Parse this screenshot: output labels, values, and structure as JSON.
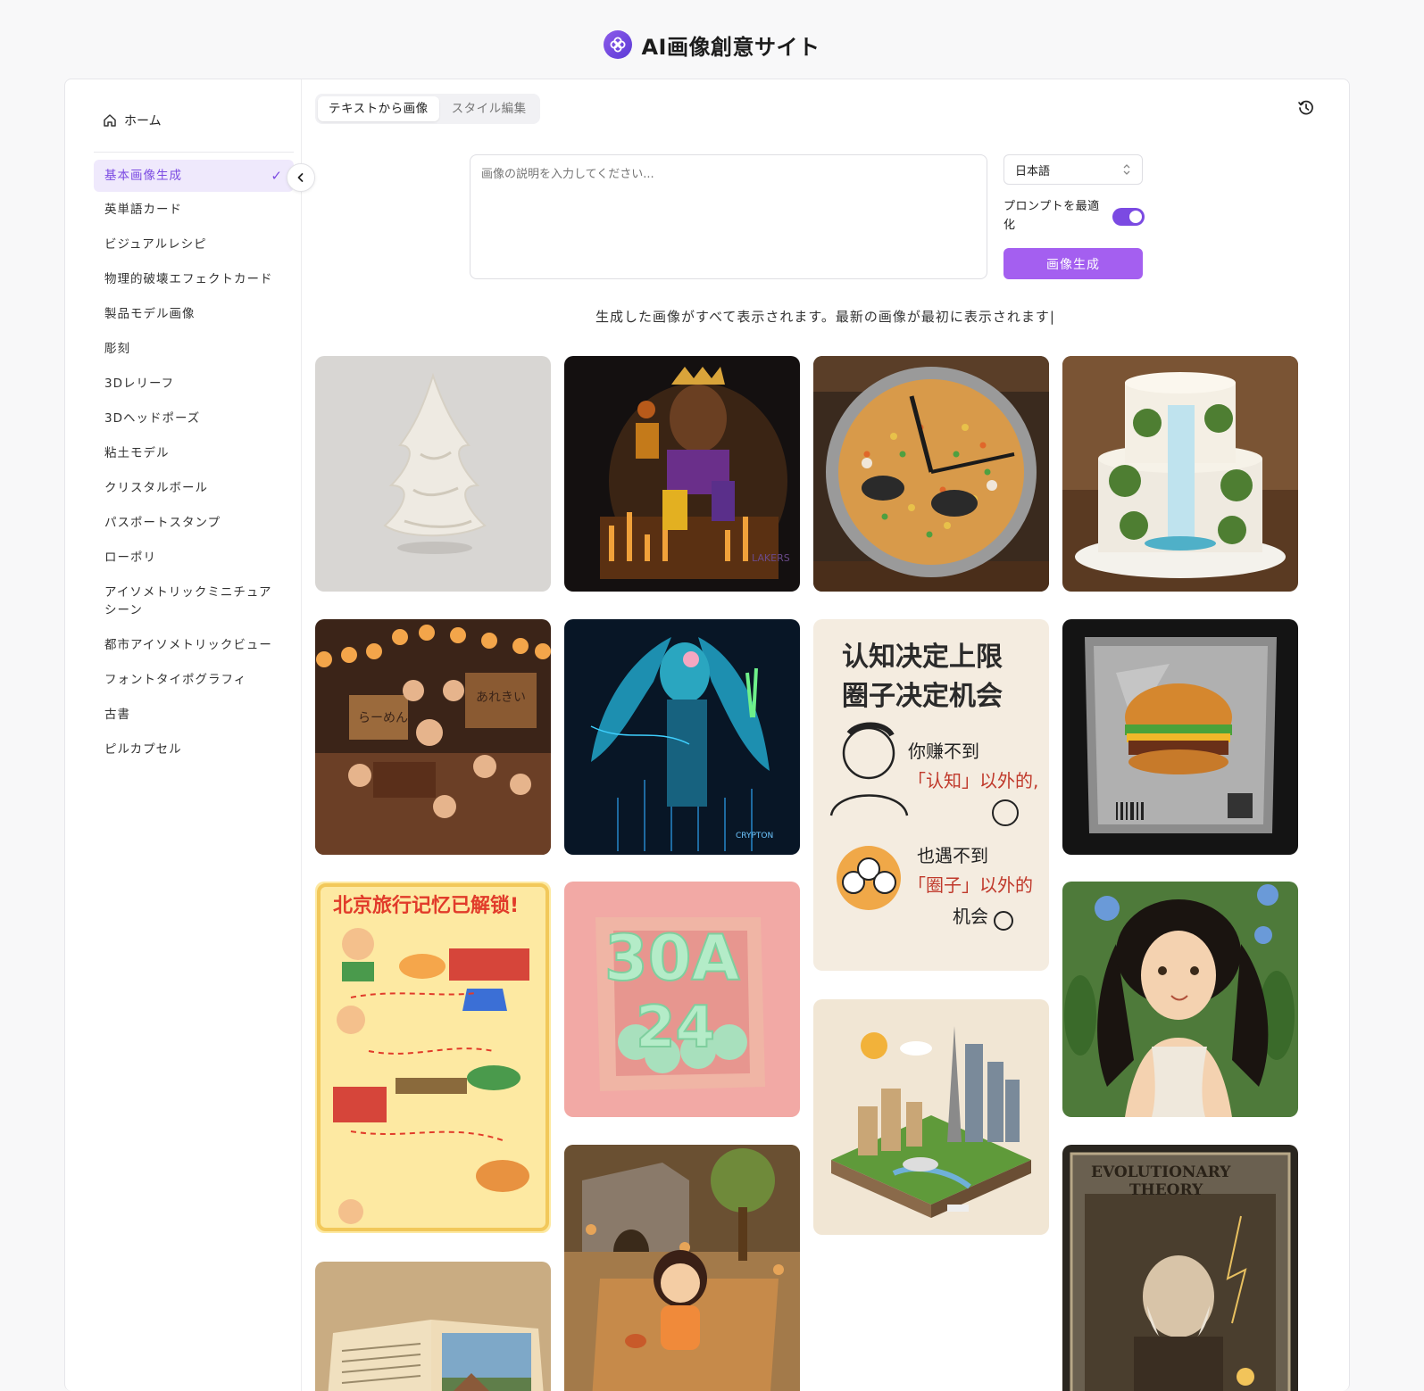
{
  "header": {
    "title": "AI画像創意サイト"
  },
  "sidebar": {
    "home_label": "ホーム",
    "items": [
      {
        "label": "基本画像生成",
        "active": true
      },
      {
        "label": "英単語カード"
      },
      {
        "label": "ビジュアルレシピ"
      },
      {
        "label": "物理的破壊エフェクトカード"
      },
      {
        "label": "製品モデル画像"
      },
      {
        "label": "彫刻"
      },
      {
        "label": "3Dレリーフ"
      },
      {
        "label": "3Dヘッドポーズ"
      },
      {
        "label": "粘土モデル"
      },
      {
        "label": "クリスタルボール"
      },
      {
        "label": "パスポートスタンプ"
      },
      {
        "label": "ローポリ"
      },
      {
        "label": "アイソメトリックミニチュアシーン"
      },
      {
        "label": "都市アイソメトリックビュー"
      },
      {
        "label": "フォントタイポグラフィ"
      },
      {
        "label": "古書"
      },
      {
        "label": "ピルカプセル"
      }
    ]
  },
  "tabs": [
    {
      "label": "テキストから画像",
      "active": true
    },
    {
      "label": "スタイル編集"
    }
  ],
  "prompt": {
    "placeholder": "画像の説明を入力してください...",
    "value": ""
  },
  "language": {
    "selected": "日本語"
  },
  "optimize": {
    "label": "プロンプトを最適化",
    "enabled": true
  },
  "generate_button": "画像生成",
  "info_text": "生成した画像がすべて表示されます。最新の画像が最初に表示されます|",
  "gallery": {
    "cards": [
      {
        "subject": "white-swirl-tree"
      },
      {
        "subject": "basketball-king-poster",
        "text": "LAKERS"
      },
      {
        "subject": "fried-rice-watch"
      },
      {
        "subject": "waterfall-cake"
      },
      {
        "subject": "night-market-stalls",
        "text": [
          "らーめん",
          "あれきい"
        ]
      },
      {
        "subject": "anime-musician-neon",
        "text": "CRYPTON"
      },
      {
        "subject": "chinese-quote-poster",
        "text": [
          "认知决定上限",
          "圈子决定机会",
          "你赚不到",
          "「认知」以外的,",
          "也遇不到",
          "「圈子」以外的",
          "机会"
        ]
      },
      {
        "subject": "burger-pouch"
      },
      {
        "subject": "beijing-travel-map",
        "text": [
          "北京旅行记忆已解锁!"
        ]
      },
      {
        "subject": "mint-letters-box",
        "text": [
          "30A",
          "24"
        ]
      },
      {
        "subject": "anime-girl-forest"
      },
      {
        "subject": "isometric-city"
      },
      {
        "subject": "chibi-girl-garden"
      },
      {
        "subject": "evolutionary-theory-card",
        "text": [
          "EVOLUTIONARY",
          "THEORY"
        ]
      },
      {
        "subject": "open-old-book"
      }
    ]
  },
  "colors": {
    "accent": "#7b4ae2",
    "button": "#a45ff0",
    "active_bg": "#efe9fc"
  }
}
